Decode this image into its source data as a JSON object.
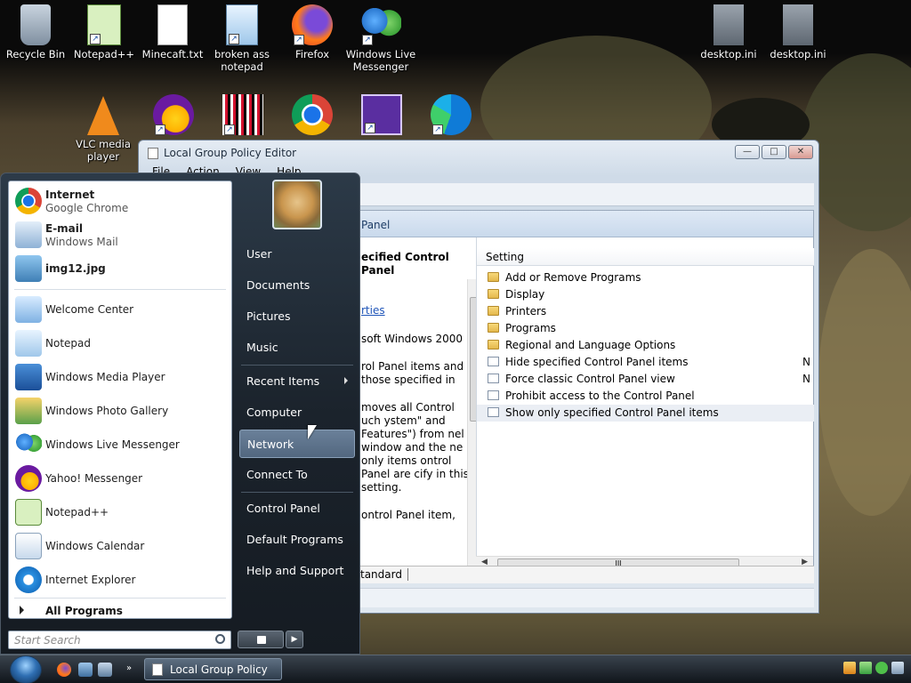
{
  "desktop": {
    "icons": [
      {
        "label": "Recycle Bin"
      },
      {
        "label": "Notepad++"
      },
      {
        "label": "Minecaft.txt"
      },
      {
        "label": "broken ass notepad"
      },
      {
        "label": "Firefox"
      },
      {
        "label": "Windows Live Messenger"
      },
      {
        "label": "desktop.ini"
      },
      {
        "label": "desktop.ini"
      },
      {
        "label": "VLC media player"
      }
    ]
  },
  "window": {
    "title": "Local Group Policy Editor",
    "menu": [
      "File",
      "Action",
      "View",
      "Help"
    ],
    "header": "Panel",
    "desc_heading": "ecified Control Panel",
    "desc_link": "rties",
    "desc_lines": [
      "soft Windows 2000",
      "rol Panel items and those specified in",
      "moves all Control uch ystem\" and Features\") from nel window and the ne only items ontrol Panel are cify in this setting.",
      "ontrol Panel item,"
    ],
    "column_header": "Setting",
    "items": [
      {
        "label": "Add or Remove Programs",
        "type": "folder",
        "state": ""
      },
      {
        "label": "Display",
        "type": "folder",
        "state": ""
      },
      {
        "label": "Printers",
        "type": "folder",
        "state": ""
      },
      {
        "label": "Programs",
        "type": "folder",
        "state": ""
      },
      {
        "label": "Regional and Language Options",
        "type": "folder",
        "state": ""
      },
      {
        "label": "Hide specified Control Panel items",
        "type": "setting",
        "state": "N"
      },
      {
        "label": "Force classic Control Panel view",
        "type": "setting",
        "state": "N"
      },
      {
        "label": "Prohibit access to the Control Panel",
        "type": "setting",
        "state": ""
      },
      {
        "label": "Show only specified Control Panel items",
        "type": "setting",
        "state": ""
      }
    ],
    "tab_standard": "tandard"
  },
  "start_menu": {
    "pinned": [
      {
        "title": "Internet",
        "subtitle": "Google Chrome"
      },
      {
        "title": "E-mail",
        "subtitle": "Windows Mail"
      },
      {
        "title": "img12.jpg",
        "subtitle": ""
      }
    ],
    "recent": [
      "Welcome Center",
      "Notepad",
      "Windows Media Player",
      "Windows Photo Gallery",
      "Windows Live Messenger",
      "Yahoo! Messenger",
      "Notepad++",
      "Windows Calendar",
      "Internet Explorer"
    ],
    "all_programs": "All Programs",
    "search_placeholder": "Start Search",
    "right_items": [
      "User",
      "Documents",
      "Pictures",
      "Music",
      "Recent Items",
      "Computer",
      "Network",
      "Connect To",
      "Control Panel",
      "Default Programs",
      "Help and Support"
    ]
  },
  "taskbar": {
    "task_label": "Local Group Policy ..."
  },
  "colors": {
    "accent": "#2f6fb3",
    "folder": "#e4b84c"
  }
}
